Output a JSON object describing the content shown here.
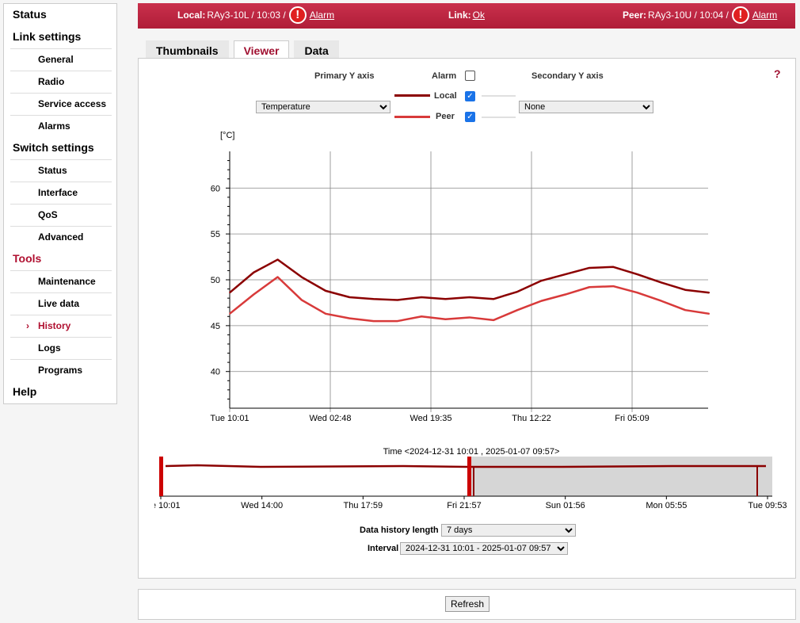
{
  "sidebar": {
    "sections": [
      {
        "label": "Status",
        "items": []
      },
      {
        "label": "Link settings",
        "items": [
          "General",
          "Radio",
          "Service access",
          "Alarms"
        ]
      },
      {
        "label": "Switch settings",
        "items": [
          "Status",
          "Interface",
          "QoS",
          "Advanced"
        ]
      },
      {
        "label": "Tools",
        "active": true,
        "items": [
          "Maintenance",
          "Live data",
          "History",
          "Logs",
          "Programs"
        ]
      },
      {
        "label": "Help",
        "items": []
      }
    ],
    "active_item": "History"
  },
  "topbar": {
    "local_label": "Local:",
    "local_value": "RAy3-10L / 10:03 /",
    "local_alarm": "Alarm",
    "link_label": "Link:",
    "link_value": "Ok",
    "peer_label": "Peer:",
    "peer_value": "RAy3-10U / 10:04 /",
    "peer_alarm": "Alarm",
    "alarm_icon": "exclamation-circle-icon"
  },
  "tabs": [
    "Thumbnails",
    "Viewer",
    "Data"
  ],
  "active_tab": "Viewer",
  "controls": {
    "primary_label": "Primary Y axis",
    "primary_value": "Temperature",
    "alarm_label": "Alarm",
    "alarm_checked": false,
    "local_label": "Local",
    "local_checked": true,
    "peer_label": "Peer",
    "peer_checked": true,
    "secondary_label": "Secondary Y axis",
    "secondary_value": "None",
    "help": "?"
  },
  "colors": {
    "local": "#8b0000",
    "peer": "#d83a3a",
    "accent": "#b01030"
  },
  "chart_data": {
    "type": "line",
    "ylabel": "[°C]",
    "ylim": [
      36,
      64
    ],
    "yticks": [
      40,
      45,
      50,
      55,
      60
    ],
    "xticks": [
      "Tue 10:01",
      "Wed 02:48",
      "Wed 19:35",
      "Thu 12:22",
      "Fri 05:09"
    ],
    "xtick_times": [
      "2024-12-31 10:01",
      "2025-01-01 02:48",
      "2025-01-01 19:35",
      "2025-01-02 12:22",
      "2025-01-03 05:09"
    ],
    "xlim": [
      "2024-12-31 10:01",
      "2025-01-03 17:50"
    ],
    "grid": true,
    "x": [
      "2024-12-31 10:01",
      "2024-12-31 14:01",
      "2024-12-31 18:01",
      "2024-12-31 22:01",
      "2025-01-01 02:01",
      "2025-01-01 06:01",
      "2025-01-01 10:01",
      "2025-01-01 14:01",
      "2025-01-01 18:01",
      "2025-01-01 22:01",
      "2025-01-02 02:01",
      "2025-01-02 06:01",
      "2025-01-02 10:01",
      "2025-01-02 14:01",
      "2025-01-02 18:01",
      "2025-01-02 22:01",
      "2025-01-03 02:01",
      "2025-01-03 06:01",
      "2025-01-03 10:01",
      "2025-01-03 14:01",
      "2025-01-03 18:01"
    ],
    "series": [
      {
        "name": "Local",
        "values": [
          48.6,
          50.8,
          52.2,
          50.3,
          48.8,
          48.1,
          47.9,
          47.8,
          48.1,
          47.9,
          48.1,
          47.9,
          48.7,
          49.9,
          50.6,
          51.3,
          51.4,
          50.6,
          49.7,
          48.9,
          48.6
        ]
      },
      {
        "name": "Peer",
        "values": [
          46.3,
          48.4,
          50.3,
          47.8,
          46.3,
          45.8,
          45.5,
          45.5,
          46.0,
          45.7,
          45.9,
          45.6,
          46.7,
          47.7,
          48.4,
          49.2,
          49.3,
          48.6,
          47.7,
          46.7,
          46.3
        ]
      }
    ]
  },
  "overview": {
    "title": "Time <2024-12-31 10:01 , 2025-01-07 09:57>",
    "xticks": [
      "Tue 10:01",
      "Wed 14:00",
      "Thu 17:59",
      "Fri 21:57",
      "Sun 01:56",
      "Mon 05:55",
      "Tue 09:53"
    ],
    "selected_fraction": [
      0.5,
      1.0
    ]
  },
  "footer": {
    "history_label": "Data history length",
    "history_value": "7 days",
    "interval_label": "Interval",
    "interval_value": "2024-12-31 10:01 - 2025-01-07 09:57",
    "refresh": "Refresh"
  }
}
